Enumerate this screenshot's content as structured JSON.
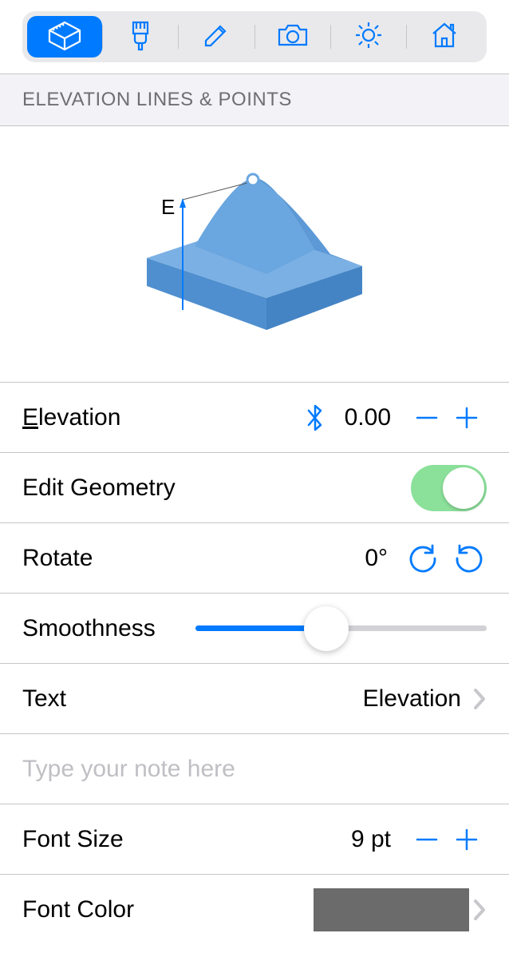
{
  "section": {
    "title": "ELEVATION LINES & POINTS"
  },
  "preview": {
    "label": "E"
  },
  "rows": {
    "elevation": {
      "label": "Elevation",
      "value": "0.00"
    },
    "editGeometry": {
      "label": "Edit Geometry",
      "on": true
    },
    "rotate": {
      "label": "Rotate",
      "value": "0°"
    },
    "smoothness": {
      "label": "Smoothness",
      "percent": 45
    },
    "text": {
      "label": "Text",
      "value": "Elevation"
    },
    "note": {
      "placeholder": "Type your note here",
      "value": ""
    },
    "fontSize": {
      "label": "Font Size",
      "value": "9 pt"
    },
    "fontColor": {
      "label": "Font Color",
      "hex": "#6b6b6b"
    }
  },
  "toolbar": {
    "items": [
      "design-tool",
      "brush-tool",
      "pencil-tool",
      "camera-tool",
      "sun-tool",
      "home-tool"
    ],
    "activeIndex": 0
  }
}
